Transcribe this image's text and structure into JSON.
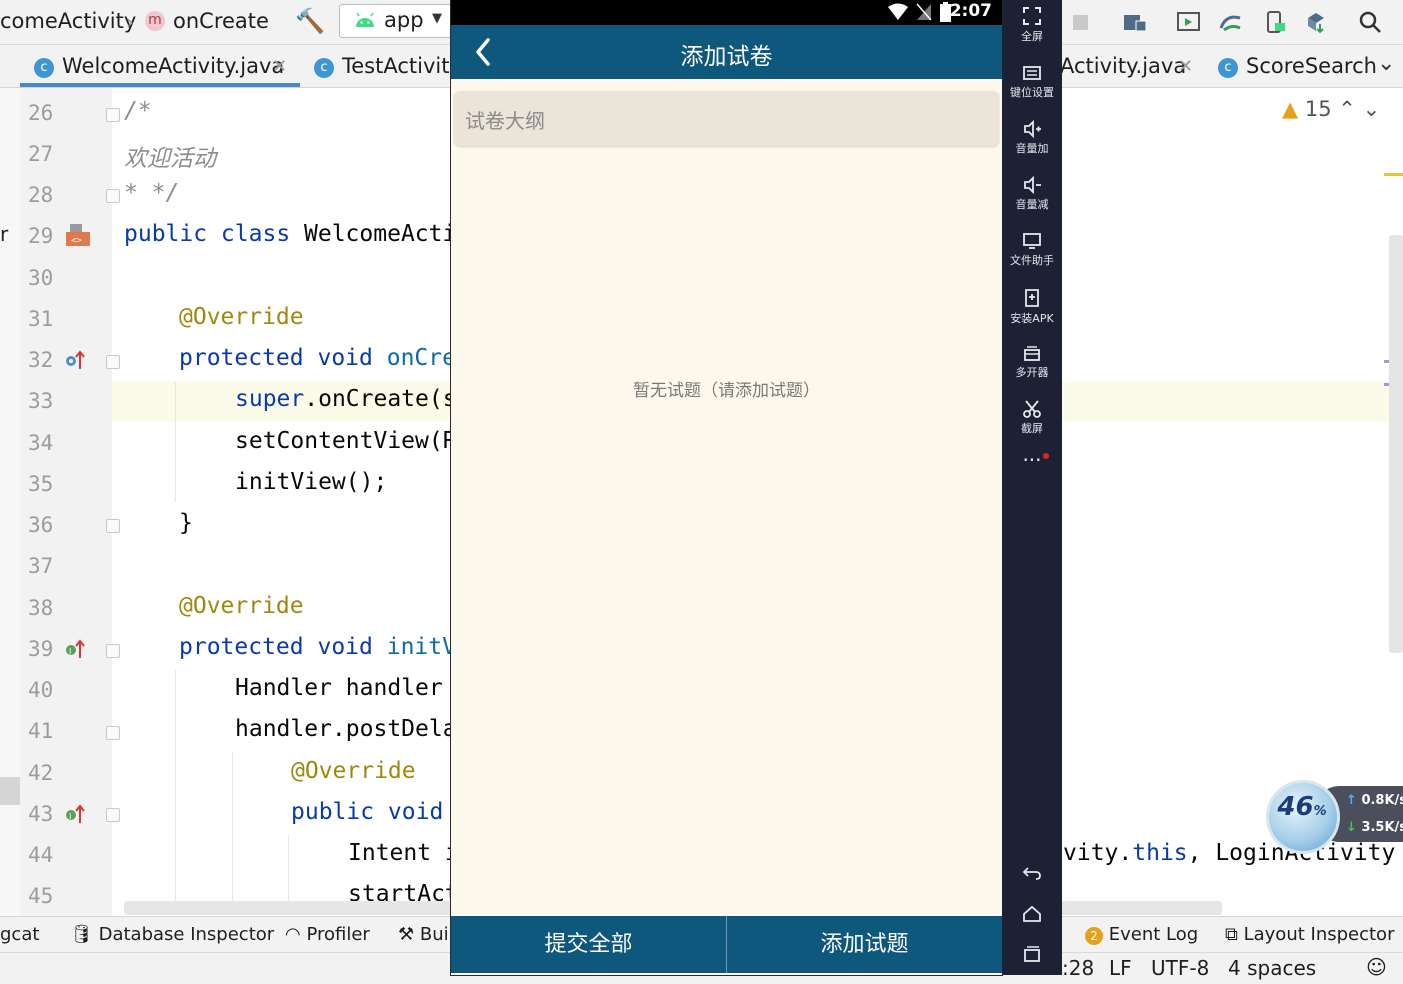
{
  "ide": {
    "breadcrumb": {
      "class": "comeActivity",
      "method": "onCreate"
    },
    "run_config": "app",
    "tabs": [
      "WelcomeActivity.java",
      "TestActivity",
      "Activity.java",
      "ScoreSearch"
    ],
    "warnings_count": "15",
    "left_edge_char": "r",
    "code_lines": [
      {
        "n": "26"
      },
      {
        "n": "27"
      },
      {
        "n": "28"
      },
      {
        "n": "29"
      },
      {
        "n": "30"
      },
      {
        "n": "31"
      },
      {
        "n": "32"
      },
      {
        "n": "33"
      },
      {
        "n": "34"
      },
      {
        "n": "35"
      },
      {
        "n": "36"
      },
      {
        "n": "37"
      },
      {
        "n": "38"
      },
      {
        "n": "39"
      },
      {
        "n": "40"
      },
      {
        "n": "41"
      },
      {
        "n": "42"
      },
      {
        "n": "43"
      },
      {
        "n": "44"
      },
      {
        "n": "45"
      }
    ],
    "code": {
      "l26": "/*",
      "l27": "欢迎活动",
      "l28": "* */",
      "l29_kw": "public class",
      "l29_rest": " WelcomeActi",
      "l31": "@Override",
      "l32_kw": "protected void",
      "l32_fn": " onCre",
      "l33_kw": "super",
      "l33_rest": ".onCreate(s",
      "l34": "setContentView(R",
      "l35": "initView();",
      "l36": "}",
      "l38": "@Override",
      "l39_kw": "protected void",
      "l39_fn": " initV",
      "l40": "Handler handler",
      "l41": "handler.postDela",
      "l42": "@Override",
      "l43_kw": "public void",
      "l44": "Intent i",
      "l44_right_pre": "vity.",
      "l44_right_kw": "this",
      "l44_right_post": ", LoginActivity",
      "l45": "startAct"
    },
    "tool_windows": [
      "gcat",
      "Database Inspector",
      "Profiler",
      "Bui",
      "Event Log",
      "Layout Inspector"
    ],
    "event_log_badge": "2",
    "status": {
      "position": ":28",
      "line_sep": "LF",
      "encoding": "UTF-8",
      "indent": "4 spaces"
    }
  },
  "phone": {
    "clock": "2:07",
    "title": "添加试卷",
    "outline_placeholder": "试卷大纲",
    "empty_text": "暂无试题（请添加试题）",
    "submit_all": "提交全部",
    "add_question": "添加试题",
    "colors": {
      "appbar": "#0e577d",
      "background": "#fdf8ec"
    }
  },
  "emulator": {
    "items": [
      "全屏",
      "键位设置",
      "音量加",
      "音量减",
      "文件助手",
      "安装APK",
      "多开器",
      "截屏"
    ]
  },
  "speed_widget": {
    "percent": "46",
    "up": "0.8K/s",
    "down": "3.5K/s"
  }
}
